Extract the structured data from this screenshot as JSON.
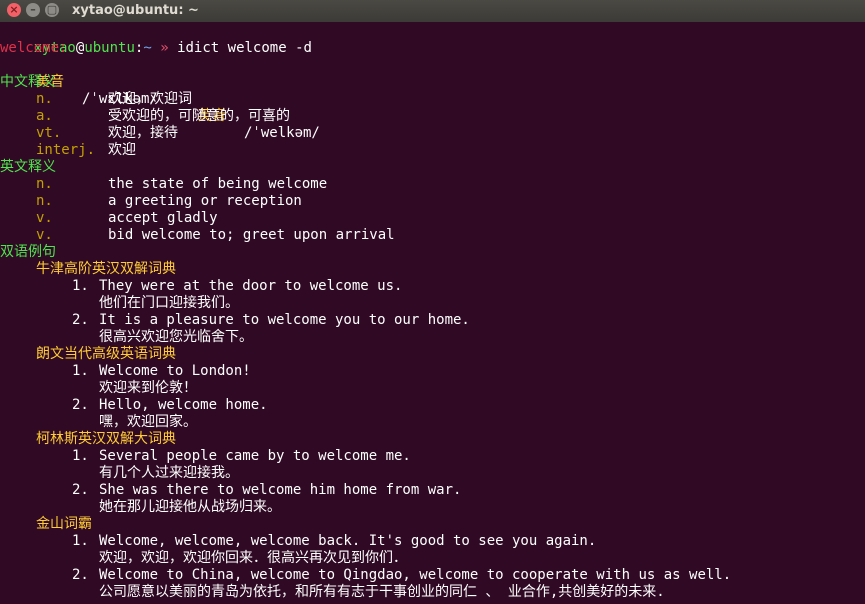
{
  "window": {
    "title": "xytao@ubuntu: ~",
    "close_glyph": "×",
    "min_glyph": "–",
    "max_glyph": "▢"
  },
  "prompt": {
    "user": "xytao",
    "at": "@",
    "host": "ubuntu",
    "sep": ":",
    "path": "~",
    "arrow": "»",
    "command": "idict welcome -d"
  },
  "word": "welcome:",
  "pron": {
    "us_label": "美音",
    "us_ipa": "/ˈwɛlkəm/",
    "uk_label": "英音",
    "uk_ipa": "/ˈwelkəm/"
  },
  "cn_heading": "中文释义",
  "cn_defs": [
    {
      "pos": "n.",
      "text": "欢迎，欢迎词"
    },
    {
      "pos": "a.",
      "text": "受欢迎的，可随意的，可喜的"
    },
    {
      "pos": "vt.",
      "text": "欢迎，接待"
    },
    {
      "pos": "interj.",
      "text": "欢迎"
    }
  ],
  "en_heading": "英文释义",
  "en_defs": [
    {
      "pos": "n.",
      "text": "the state of being welcome"
    },
    {
      "pos": "n.",
      "text": "a greeting or reception"
    },
    {
      "pos": "v.",
      "text": "accept gladly"
    },
    {
      "pos": "v.",
      "text": "bid welcome to; greet upon arrival"
    }
  ],
  "ex_heading": "双语例句",
  "sources": [
    {
      "name": "牛津高阶英汉双解词典",
      "examples": [
        {
          "num": "1.",
          "en": "They were at the door to welcome us.",
          "zh": "他们在门口迎接我们。"
        },
        {
          "num": "2.",
          "en": "It is a pleasure to welcome you to our home.",
          "zh": "很高兴欢迎您光临舍下。"
        }
      ]
    },
    {
      "name": "朗文当代高级英语词典",
      "examples": [
        {
          "num": "1.",
          "en": "Welcome to London!",
          "zh": "欢迎来到伦敦！"
        },
        {
          "num": "2.",
          "en": "Hello, welcome home.",
          "zh": "嘿，欢迎回家。"
        }
      ]
    },
    {
      "name": "柯林斯英汉双解大词典",
      "examples": [
        {
          "num": "1.",
          "en": "Several people came by to welcome me.",
          "zh": "有几个人过来迎接我。"
        },
        {
          "num": "2.",
          "en": "She was there to welcome him home from war.",
          "zh": "她在那儿迎接他从战场归来。"
        }
      ]
    },
    {
      "name": "金山词霸",
      "examples": [
        {
          "num": "1.",
          "en": "Welcome, welcome, welcome back. It's good to see you again.",
          "zh": "欢迎，欢迎，欢迎你回来．很高兴再次见到你们．"
        },
        {
          "num": "2.",
          "en": "Welcome to China, welcome to Qingdao, welcome to cooperate with us as well.",
          "zh": "公司愿意以美丽的青岛为依托，和所有有志于干事创业的同仁 、 业合作,共创美好的未来."
        }
      ]
    }
  ]
}
